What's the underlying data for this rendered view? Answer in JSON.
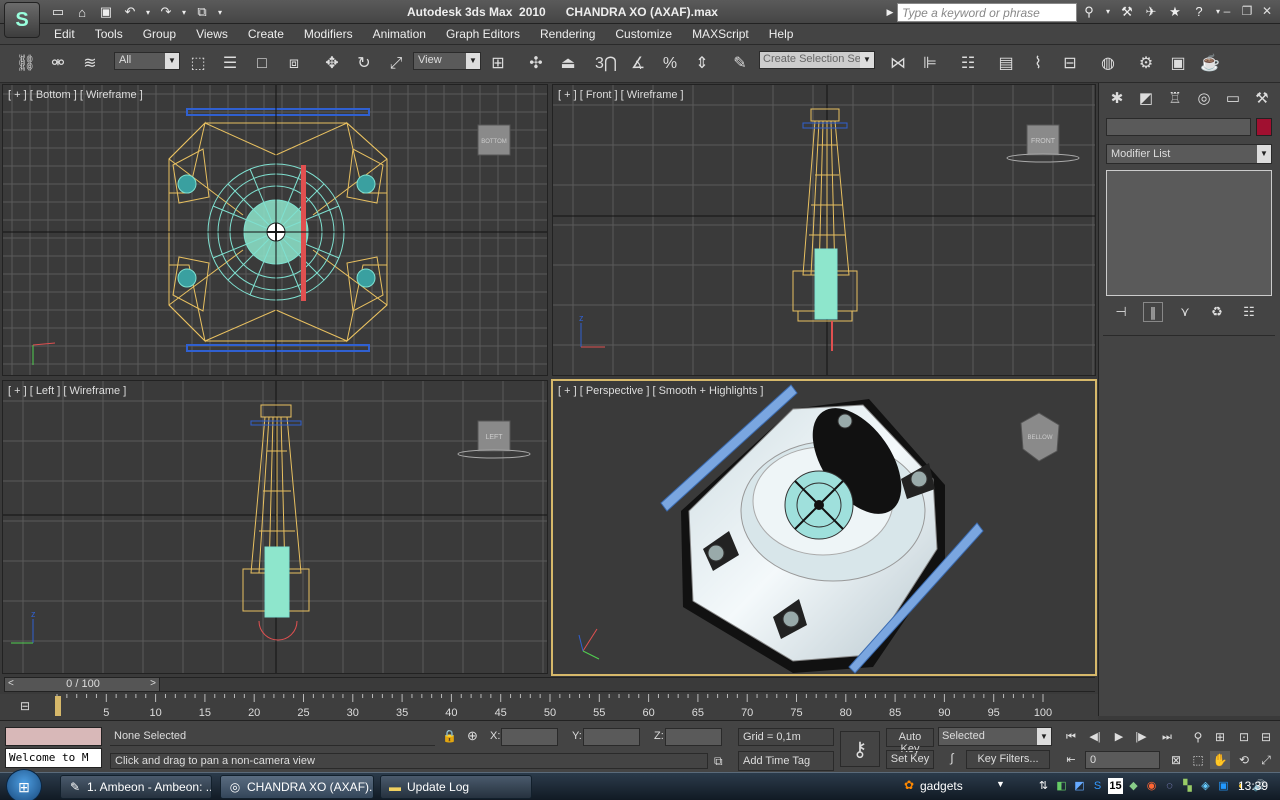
{
  "window": {
    "title": "Autodesk 3ds Max  2010      CHANDRA XO (AXAF).max",
    "search_placeholder": "Type a keyword or phrase"
  },
  "menu": [
    "Edit",
    "Tools",
    "Group",
    "Views",
    "Create",
    "Modifiers",
    "Animation",
    "Graph Editors",
    "Rendering",
    "Customize",
    "MAXScript",
    "Help"
  ],
  "toolbar": {
    "filter": "All",
    "ref_coord": "View",
    "selection_set_placeholder": "Create Selection Se"
  },
  "viewports": {
    "bottom": {
      "label": "[ + ] [ Bottom ] [ Wireframe ]",
      "cube": "BOTTOM"
    },
    "front": {
      "label": "[ + ] [ Front ] [ Wireframe ]",
      "cube": "FRONT"
    },
    "left": {
      "label": "[ + ] [ Left ] [ Wireframe ]",
      "cube": "LEFT"
    },
    "perspective": {
      "label": "[ + ] [ Perspective ] [ Smooth + Highlights ]",
      "cube": "BELLOW"
    }
  },
  "command_panel": {
    "modifier_list": "Modifier List"
  },
  "timeline": {
    "slider_label": "0 / 100",
    "ticks": [
      "5",
      "10",
      "15",
      "20",
      "25",
      "30",
      "35",
      "40",
      "45",
      "50",
      "55",
      "60",
      "65",
      "70",
      "75",
      "80",
      "85",
      "90",
      "95",
      "100"
    ]
  },
  "status": {
    "maxscript": "Welcome to M",
    "selection": "None Selected",
    "prompt": "Click and drag to pan a non-camera view",
    "x_label": "X:",
    "y_label": "Y:",
    "z_label": "Z:",
    "grid": "Grid = 0,1m",
    "add_time_tag": "Add Time Tag",
    "auto_key": "Auto Key",
    "set_key": "Set Key",
    "key_mode": "Selected",
    "key_filters": "Key Filters...",
    "frame": "0"
  },
  "taskbar": {
    "tasks": [
      "1. Ambeon - Ambeon: ...",
      "CHANDRA XO (AXAF)....",
      "Update Log"
    ],
    "gadgets": "gadgets",
    "clock": "13:39",
    "tray_badge": "15"
  },
  "colors": {
    "wire_yellow": "#e8c060",
    "wire_cyan": "#7fe0d0",
    "wire_blue": "#3060d0",
    "wire_red": "#e05050",
    "active_border": "#d6b86a"
  }
}
